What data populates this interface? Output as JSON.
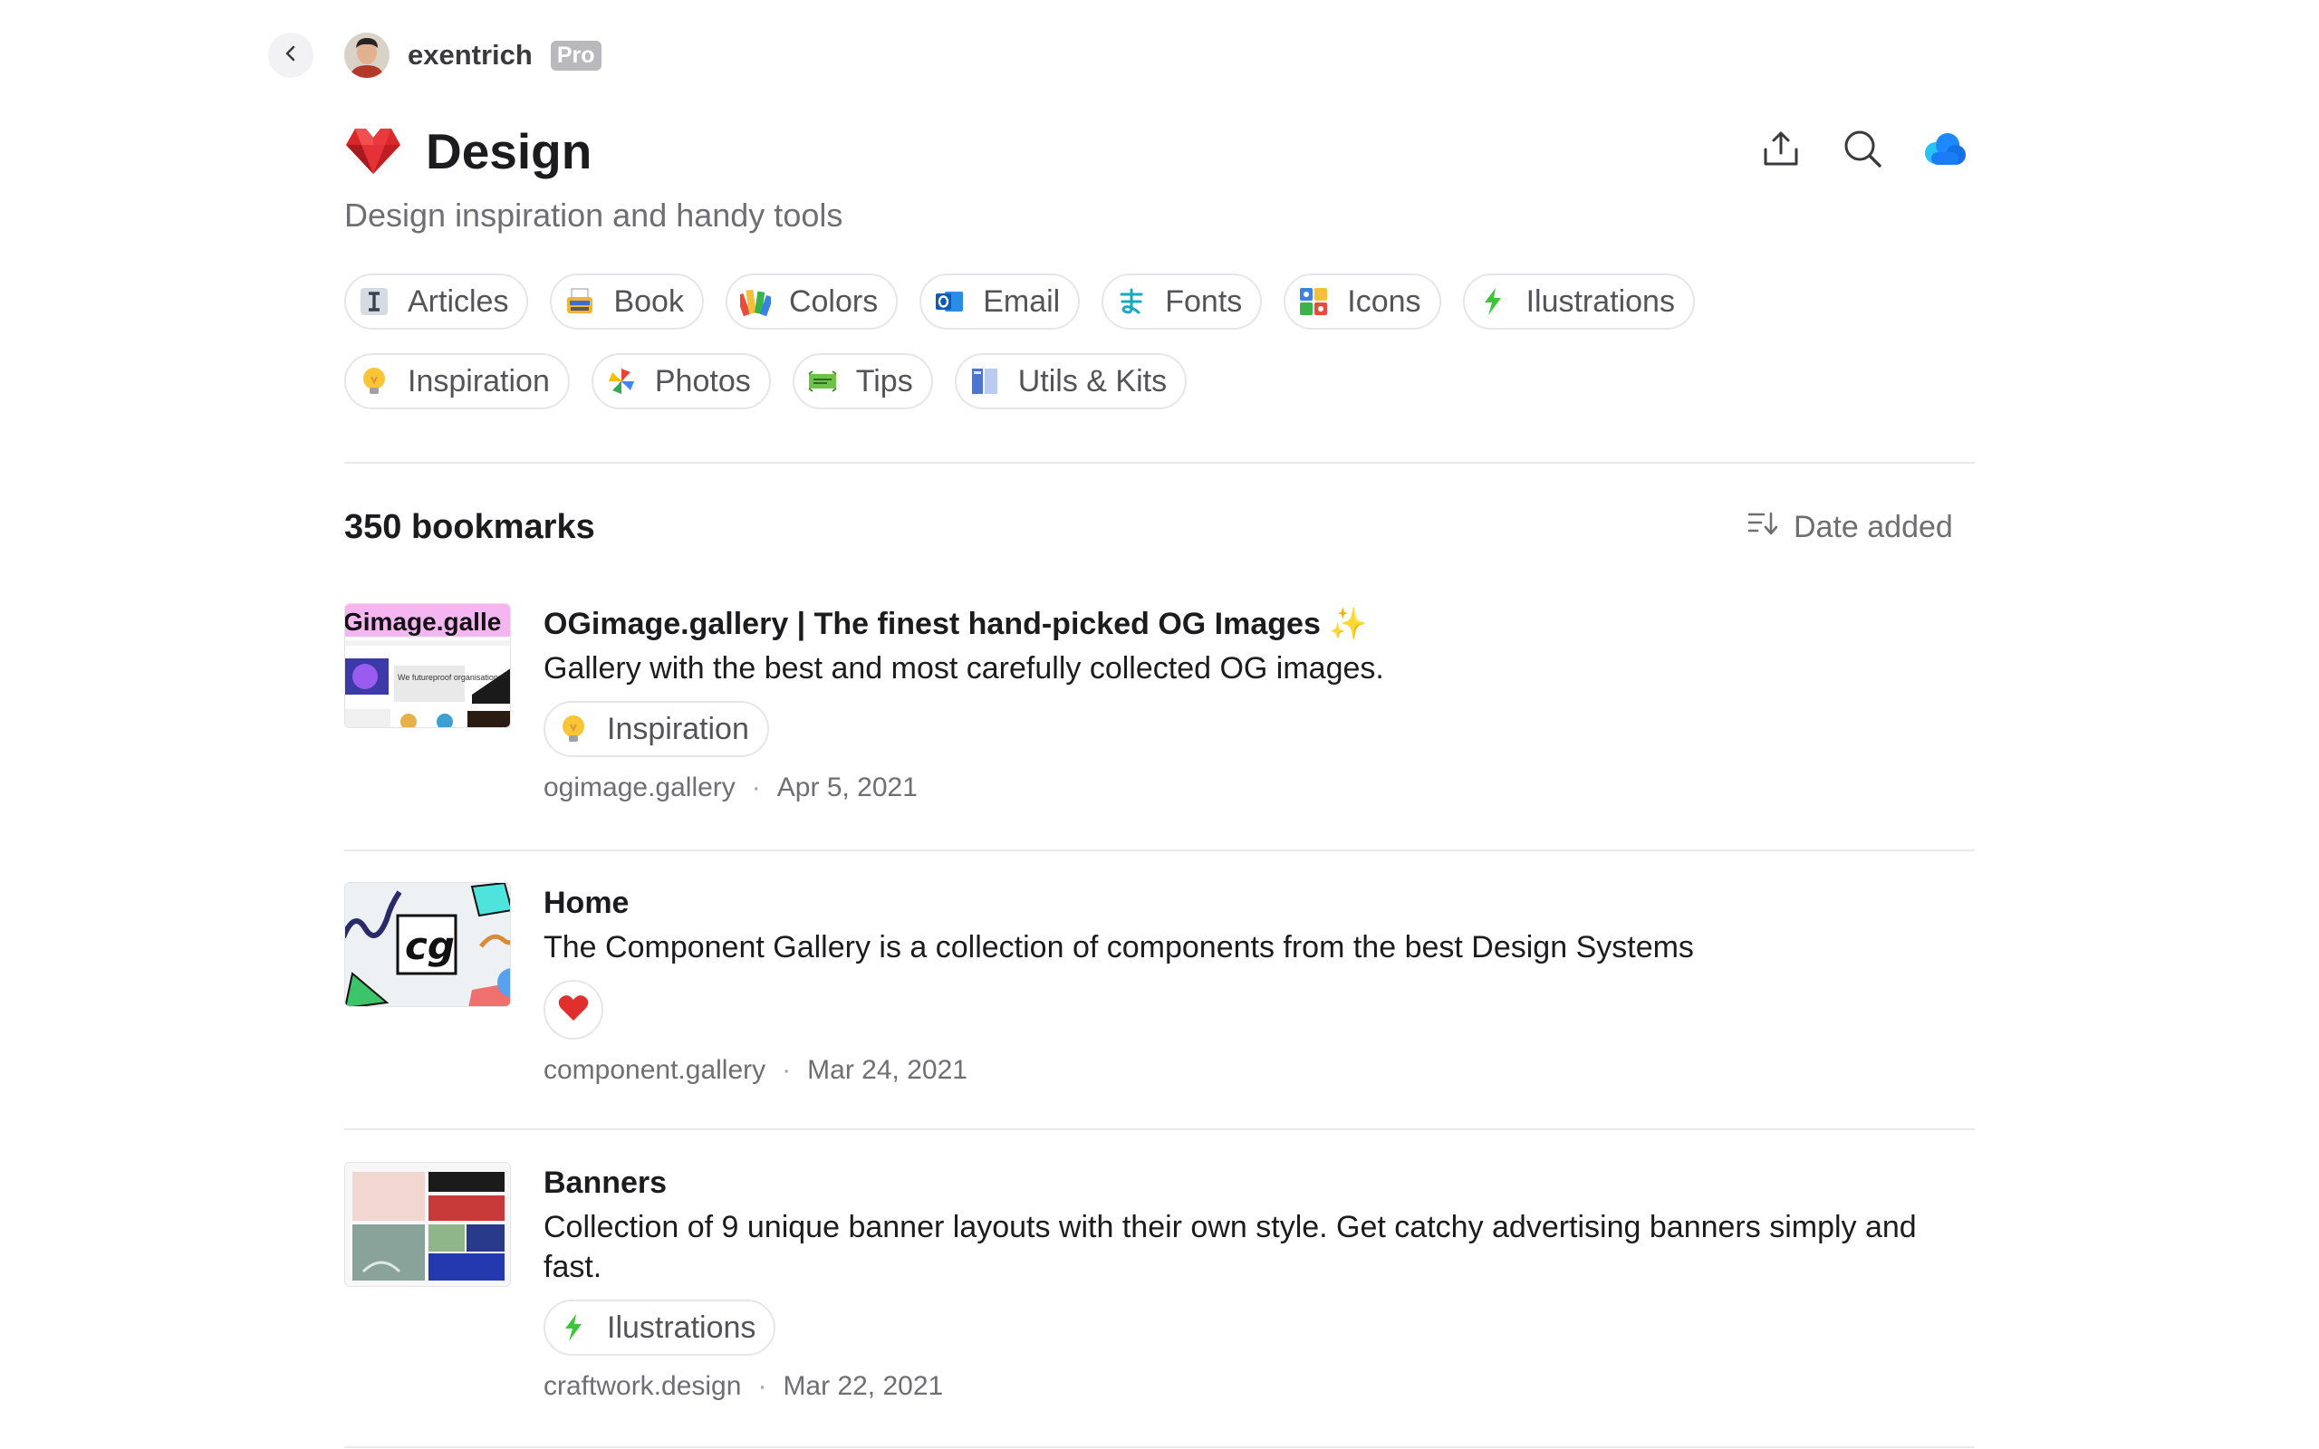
{
  "owner": {
    "name": "exentrich",
    "badge": "Pro"
  },
  "collection": {
    "title": "Design",
    "subtitle": "Design inspiration and handy tools"
  },
  "tags": [
    {
      "label": "Articles",
      "icon": "text-cursor-icon"
    },
    {
      "label": "Book",
      "icon": "typewriter-icon"
    },
    {
      "label": "Colors",
      "icon": "palette-icon"
    },
    {
      "label": "Email",
      "icon": "outlook-icon"
    },
    {
      "label": "Fonts",
      "icon": "kana-icon"
    },
    {
      "label": "Icons",
      "icon": "icon-grid-icon"
    },
    {
      "label": "Ilustrations",
      "icon": "lightning-icon"
    },
    {
      "label": "Inspiration",
      "icon": "lightbulb-icon"
    },
    {
      "label": "Photos",
      "icon": "pinwheel-icon"
    },
    {
      "label": "Tips",
      "icon": "banner-icon"
    },
    {
      "label": "Utils & Kits",
      "icon": "kit-icon"
    }
  ],
  "list": {
    "count": "350 bookmarks",
    "sort_label": "Date added"
  },
  "bookmarks": [
    {
      "title": "OGimage.gallery | The finest hand-picked OG Images ✨",
      "description": "Gallery with the best and most carefully collected OG images.",
      "tag": "Inspiration",
      "domain": "ogimage.gallery",
      "date": "Apr 5, 2021",
      "thumb_text": "Gimage.galle",
      "thumb_caption": "We futureproof organisations"
    },
    {
      "title": "Home",
      "description": "The Component Gallery is a collection of components from the best Design Systems",
      "tag": "",
      "domain": "component.gallery",
      "date": "Mar 24, 2021",
      "thumb_text": "cg"
    },
    {
      "title": "Banners",
      "description": "Collection of 9 unique banner layouts with their own style. Get catchy advertising banners simply and fast.",
      "tag": "Ilustrations",
      "domain": "craftwork.design",
      "date": "Mar 22, 2021"
    }
  ],
  "colors": {
    "accent": "#1e88ff",
    "heart": "#e0302e"
  }
}
